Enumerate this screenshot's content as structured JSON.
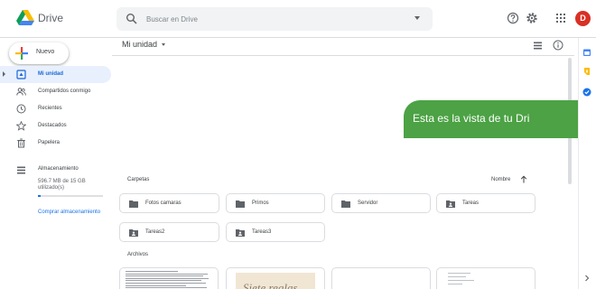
{
  "header": {
    "app_title": "Drive",
    "search_placeholder": "Buscar en Drive",
    "avatar_letter": "D",
    "icons": [
      "help-icon",
      "settings-icon",
      "apps-grid-icon"
    ]
  },
  "sidebar": {
    "new_button": "Nuevo",
    "items": [
      {
        "label": "Mi unidad",
        "icon": "my-drive-icon",
        "active": true
      },
      {
        "label": "Compartidos conmigo",
        "icon": "shared-icon",
        "active": false
      },
      {
        "label": "Recientes",
        "icon": "clock-icon",
        "active": false
      },
      {
        "label": "Destacados",
        "icon": "star-icon",
        "active": false
      },
      {
        "label": "Papelera",
        "icon": "trash-icon",
        "active": false
      }
    ],
    "storage": {
      "title": "Almacenamiento",
      "usage_text": "596.7 MB de 15 GB utilizado(s)",
      "used_fraction": 0.04,
      "buy_link": "Comprar almacenamiento"
    }
  },
  "main": {
    "breadcrumb": "Mi unidad",
    "tooltip": "Esta es la vista de tu Dri",
    "folders_label": "Carpetas",
    "sort_label": "Nombre",
    "folders": [
      {
        "name": "Fotos camaras",
        "icon": "folder-icon"
      },
      {
        "name": "Primos",
        "icon": "folder-icon"
      },
      {
        "name": "Servidor",
        "icon": "folder-icon"
      },
      {
        "name": "Tareas",
        "icon": "shared-folder-icon"
      },
      {
        "name": "Tareas2",
        "icon": "shared-folder-icon"
      },
      {
        "name": "Tareas3",
        "icon": "shared-folder-icon"
      }
    ],
    "files_label": "Archivos",
    "file_thumb_text": "Siete reglas"
  },
  "colors": {
    "accent": "#1a73e8",
    "active_bg": "#e8f0fe",
    "tooltip_green": "#4ca244",
    "avatar_red": "#d93025"
  }
}
